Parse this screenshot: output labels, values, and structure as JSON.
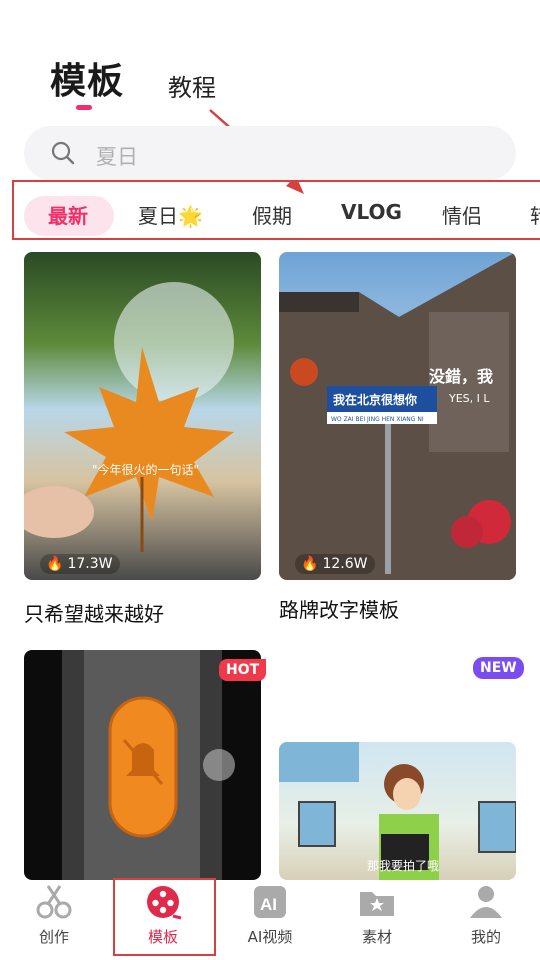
{
  "header": {
    "title": "模板",
    "secondary_tab": "教程"
  },
  "search": {
    "placeholder": "夏日"
  },
  "categories": [
    {
      "label": "最新",
      "active": true
    },
    {
      "label": "夏日🌟",
      "active": false
    },
    {
      "label": "假期",
      "active": false
    },
    {
      "label": "VLOG",
      "active": false
    },
    {
      "label": "情侣",
      "active": false
    },
    {
      "label": "转",
      "active": false
    }
  ],
  "cards": [
    {
      "title": "只希望越来越好",
      "uses": "17.3W",
      "overlay_text": "\"今年很火的一句话\"",
      "badge": ""
    },
    {
      "title": "路牌改字模板",
      "uses": "12.6W",
      "overlay_text": "我在北京很想你",
      "overlay_sub": "WO ZAI BEI JING HEN XIANG NI",
      "overlay_side": "没錯，我",
      "overlay_side_en": "YES, I L",
      "badge": ""
    },
    {
      "title": "",
      "uses": "",
      "badge": "HOT"
    },
    {
      "title": "",
      "uses": "",
      "overlay_text": "那我要拍了哦",
      "badge": "NEW"
    }
  ],
  "bottom_nav": [
    {
      "label": "创作",
      "icon": "scissors-icon",
      "active": false
    },
    {
      "label": "模板",
      "icon": "film-reel-icon",
      "active": true
    },
    {
      "label": "AI视频",
      "icon": "ai-icon",
      "active": false
    },
    {
      "label": "素材",
      "icon": "folder-star-icon",
      "active": false
    },
    {
      "label": "我的",
      "icon": "person-icon",
      "active": false
    }
  ],
  "colors": {
    "accent": "#f0306a",
    "annotation": "#d84040",
    "hot": "#f03a4c",
    "new": "#7b4cf0"
  }
}
